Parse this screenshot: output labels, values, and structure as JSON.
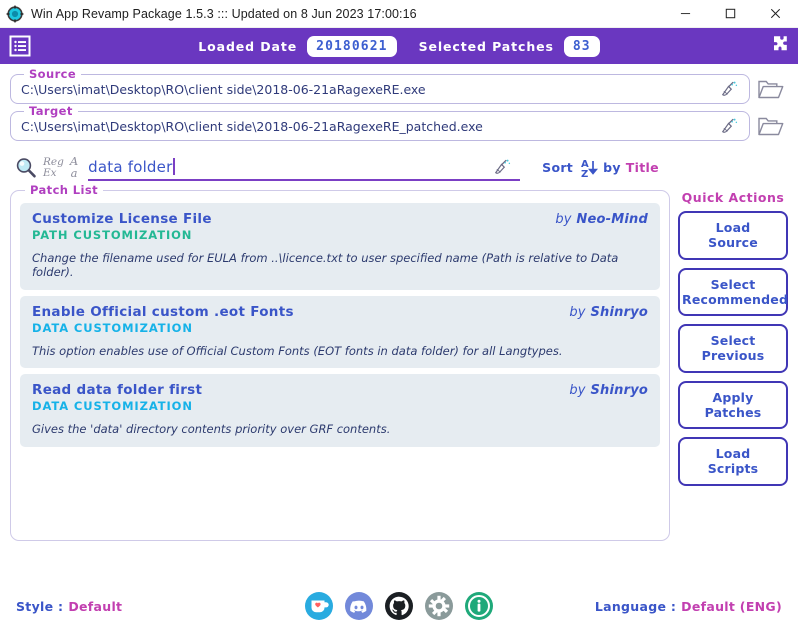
{
  "window": {
    "title": "Win App Revamp Package 1.5.3  :::  Updated on 8 Jun 2023 17:00:16",
    "app_icon": "gear-circle-icon",
    "minimize": "–",
    "maximize": "☐",
    "close": "✕"
  },
  "header": {
    "menu_icon": "list-menu-icon",
    "loaded_date_label": "Loaded Date",
    "loaded_date_value": "20180621",
    "selected_patches_label": "Selected Patches",
    "selected_patches_value": "83",
    "puzzle_icon": "puzzle-piece-icon",
    "bg_color": "#6a37c0"
  },
  "paths": {
    "source": {
      "legend": "Source",
      "value": "C:\\Users\\imat\\Desktop\\RO\\client side\\2018-06-21aRagexeRE.exe",
      "clear_icon": "broom-icon",
      "browse_icon": "folder-open-icon"
    },
    "target": {
      "legend": "Target",
      "value": "C:\\Users\\imat\\Desktop\\RO\\client side\\2018-06-21aRagexeRE_patched.exe",
      "clear_icon": "broom-icon",
      "browse_icon": "folder-open-icon"
    }
  },
  "search": {
    "icon": "magnifier-icon",
    "regex_top": "Reg",
    "regex_bottom": "Ex",
    "case_top": "A",
    "case_bottom": "a",
    "value": "data folder",
    "placeholder": "",
    "clear_icon": "broom-icon"
  },
  "sort": {
    "prefix": "Sort",
    "order_icon": "sort-a-z-down-icon",
    "middle": "by",
    "key": "Title"
  },
  "patch_list": {
    "legend": "Patch List",
    "items": [
      {
        "name": "Customize License File",
        "author_by": "by",
        "author": "Neo-Mind",
        "category": "PATH CUSTOMIZATION",
        "category_color": "#23b894",
        "description": "Change the filename used for EULA from ..\\licence.txt to user specified name (Path is relative to Data folder)."
      },
      {
        "name": "Enable Official custom .eot Fonts",
        "author_by": "by",
        "author": "Shinryo",
        "category": "DATA CUSTOMIZATION",
        "category_color": "#16b2e8",
        "description": "This option enables use of Official Custom Fonts (EOT fonts in data folder) for all Langtypes."
      },
      {
        "name": "Read data folder first",
        "author_by": "by",
        "author": "Shinryo",
        "category": "DATA CUSTOMIZATION",
        "category_color": "#16b2e8",
        "description": "Gives the 'data' directory contents priority over GRF contents."
      }
    ]
  },
  "quick_actions": {
    "title": "Quick Actions",
    "buttons": [
      {
        "line1": "Load",
        "line2": "Source"
      },
      {
        "line1": "Select",
        "line2": "Recommended"
      },
      {
        "line1": "Select",
        "line2": "Previous"
      },
      {
        "line1": "Apply",
        "line2": "Patches"
      },
      {
        "line1": "Load",
        "line2": "Scripts"
      }
    ]
  },
  "footer": {
    "style_label": "Style :",
    "style_value": "Default",
    "language_label": "Language :",
    "language_value": "Default (ENG)",
    "icons": [
      {
        "name": "kofi-icon",
        "color": "#29abe0"
      },
      {
        "name": "discord-icon",
        "color": "#7289da"
      },
      {
        "name": "github-icon",
        "color": "#1b1f23"
      },
      {
        "name": "settings-gear-icon",
        "color": "#8a9a9a"
      },
      {
        "name": "info-icon",
        "color": "#1fa97a"
      }
    ]
  }
}
